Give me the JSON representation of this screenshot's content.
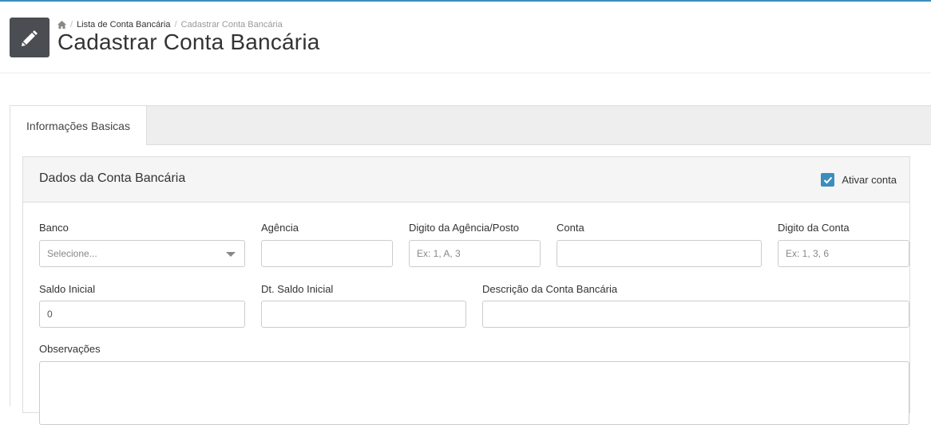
{
  "header": {
    "breadcrumb": {
      "home_icon": "home-icon",
      "separator": "/",
      "link": "Lista de Conta Bancária",
      "current": "Cadastrar Conta Bancária"
    },
    "title": "Cadastrar Conta Bancária",
    "icon": "pencil-icon",
    "accent_color": "#3c8dbc"
  },
  "tabs": [
    {
      "label": "Informações Basicas",
      "active": true
    }
  ],
  "panel": {
    "title": "Dados da Conta Bancária",
    "activate": {
      "label": "Ativar conta",
      "checked": true
    }
  },
  "form": {
    "banco": {
      "label": "Banco",
      "selected": "Selecione..."
    },
    "agencia": {
      "label": "Agência",
      "value": ""
    },
    "digito_agencia": {
      "label": "Digito da Agência/Posto",
      "placeholder": "Ex: 1, A, 3"
    },
    "conta": {
      "label": "Conta",
      "value": ""
    },
    "digito_conta": {
      "label": "Digito da Conta",
      "placeholder": "Ex: 1, 3, 6"
    },
    "saldo_inicial": {
      "label": "Saldo Inicial",
      "value": "0"
    },
    "dt_saldo_inicial": {
      "label": "Dt. Saldo Inicial",
      "value": ""
    },
    "descricao": {
      "label": "Descrição da Conta Bancária",
      "value": ""
    },
    "observacoes": {
      "label": "Observações",
      "value": ""
    }
  }
}
